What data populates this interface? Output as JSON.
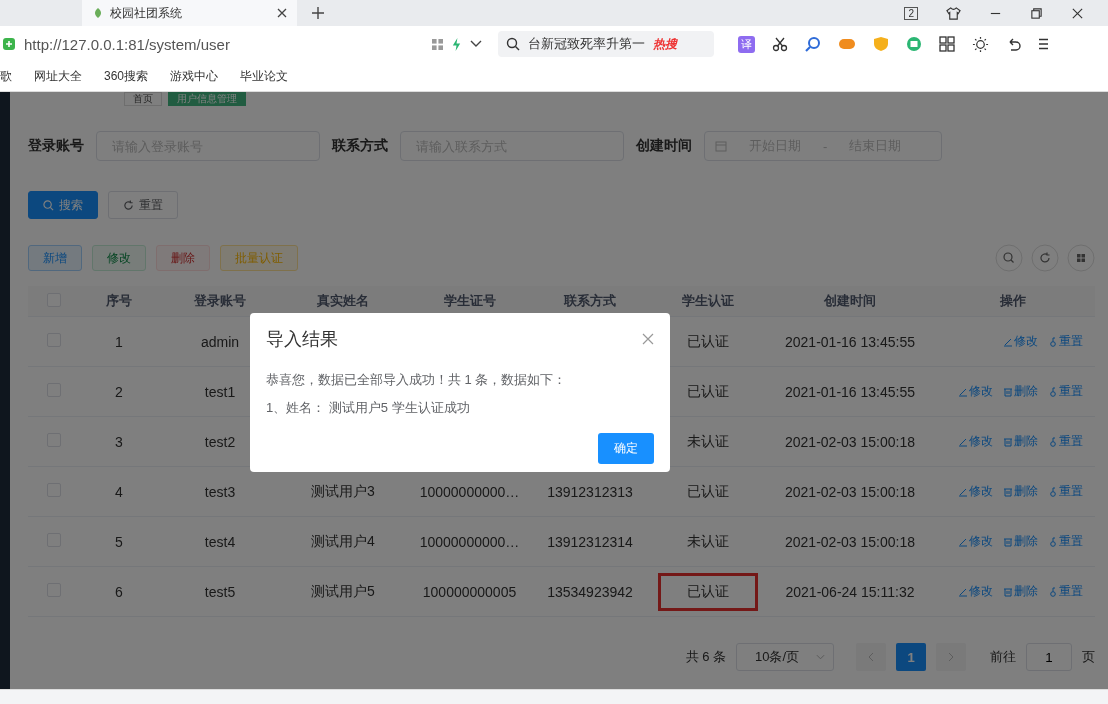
{
  "browser": {
    "tab_title": "校园社团系统",
    "window_badge": "2",
    "url": "http://127.0.0.1:81/system/user",
    "search_text": "台新冠致死率升第一",
    "search_badge": "热搜",
    "translate_label": "译",
    "bookmarks": [
      "歌",
      "网址大全",
      "360搜索",
      "游戏中心",
      "毕业论文"
    ]
  },
  "tags": [
    {
      "label": "首页",
      "selected": false
    },
    {
      "label": "用户信息管理",
      "selected": true
    }
  ],
  "search_form": {
    "fields": [
      {
        "kind": "text",
        "label": "登录账号",
        "placeholder": "请输入登录账号"
      },
      {
        "kind": "text",
        "label": "联系方式",
        "placeholder": "请输入联系方式"
      },
      {
        "kind": "daterange",
        "label": "创建时间",
        "start_placeholder": "开始日期",
        "separator": "-",
        "end_placeholder": "结束日期"
      }
    ],
    "buttons": [
      {
        "kind": "primary",
        "label": "搜索"
      },
      {
        "kind": "default",
        "label": "重置"
      }
    ]
  },
  "toolbar": [
    {
      "kind": "add",
      "label": "新增",
      "disabled": false
    },
    {
      "kind": "edit",
      "label": "修改",
      "disabled": true
    },
    {
      "kind": "delete",
      "label": "删除",
      "disabled": true
    },
    {
      "kind": "import",
      "label": "批量认证",
      "disabled": false
    }
  ],
  "table": {
    "columns": [
      "序号",
      "登录账号",
      "真实姓名",
      "学生证号",
      "联系方式",
      "学生认证",
      "创建时间",
      "操作"
    ],
    "header_checked": false,
    "rows": [
      {
        "checked": false,
        "highlighted": false,
        "cells": [
          "1",
          "admin",
          "",
          "",
          "",
          "已认证",
          "2021-01-16 13:45:55"
        ],
        "actions": [
          {
            "kind": "edit",
            "label": "修改"
          },
          {
            "kind": "reset",
            "label": "重置"
          }
        ]
      },
      {
        "checked": false,
        "highlighted": false,
        "cells": [
          "2",
          "test1",
          "",
          "",
          "",
          "已认证",
          "2021-01-16 13:45:55"
        ],
        "actions": [
          {
            "kind": "edit",
            "label": "修改"
          },
          {
            "kind": "delete",
            "label": "删除"
          },
          {
            "kind": "reset",
            "label": "重置"
          }
        ]
      },
      {
        "checked": false,
        "highlighted": false,
        "cells": [
          "3",
          "test2",
          "",
          "",
          "",
          "未认证",
          "2021-02-03 15:00:18"
        ],
        "actions": [
          {
            "kind": "edit",
            "label": "修改"
          },
          {
            "kind": "delete",
            "label": "删除"
          },
          {
            "kind": "reset",
            "label": "重置"
          }
        ]
      },
      {
        "checked": false,
        "highlighted": false,
        "cells": [
          "4",
          "test3",
          "测试用户3",
          "10000000000…",
          "13912312313",
          "已认证",
          "2021-02-03 15:00:18"
        ],
        "actions": [
          {
            "kind": "edit",
            "label": "修改"
          },
          {
            "kind": "delete",
            "label": "删除"
          },
          {
            "kind": "reset",
            "label": "重置"
          }
        ]
      },
      {
        "checked": false,
        "highlighted": false,
        "cells": [
          "5",
          "test4",
          "测试用户4",
          "10000000000…",
          "13912312314",
          "未认证",
          "2021-02-03 15:00:18"
        ],
        "actions": [
          {
            "kind": "edit",
            "label": "修改"
          },
          {
            "kind": "delete",
            "label": "删除"
          },
          {
            "kind": "reset",
            "label": "重置"
          }
        ]
      },
      {
        "checked": false,
        "highlighted": true,
        "cells": [
          "6",
          "test5",
          "测试用户5",
          "100000000005",
          "13534923942",
          "已认证",
          "2021-06-24 15:11:32"
        ],
        "actions": [
          {
            "kind": "edit",
            "label": "修改"
          },
          {
            "kind": "delete",
            "label": "删除"
          },
          {
            "kind": "reset",
            "label": "重置"
          }
        ]
      }
    ]
  },
  "pagination": {
    "total": "共 6 条",
    "page_size": "10条/页",
    "pages": [
      {
        "label": "1",
        "selected": true
      }
    ],
    "goto_label": "前往",
    "goto_value": "1",
    "goto_suffix": "页"
  },
  "dialog": {
    "title": "导入结果",
    "lines": [
      "恭喜您，数据已全部导入成功！共 1 条，数据如下：",
      "1、姓名： 测试用户5 学生认证成功"
    ],
    "confirm": "确定"
  }
}
